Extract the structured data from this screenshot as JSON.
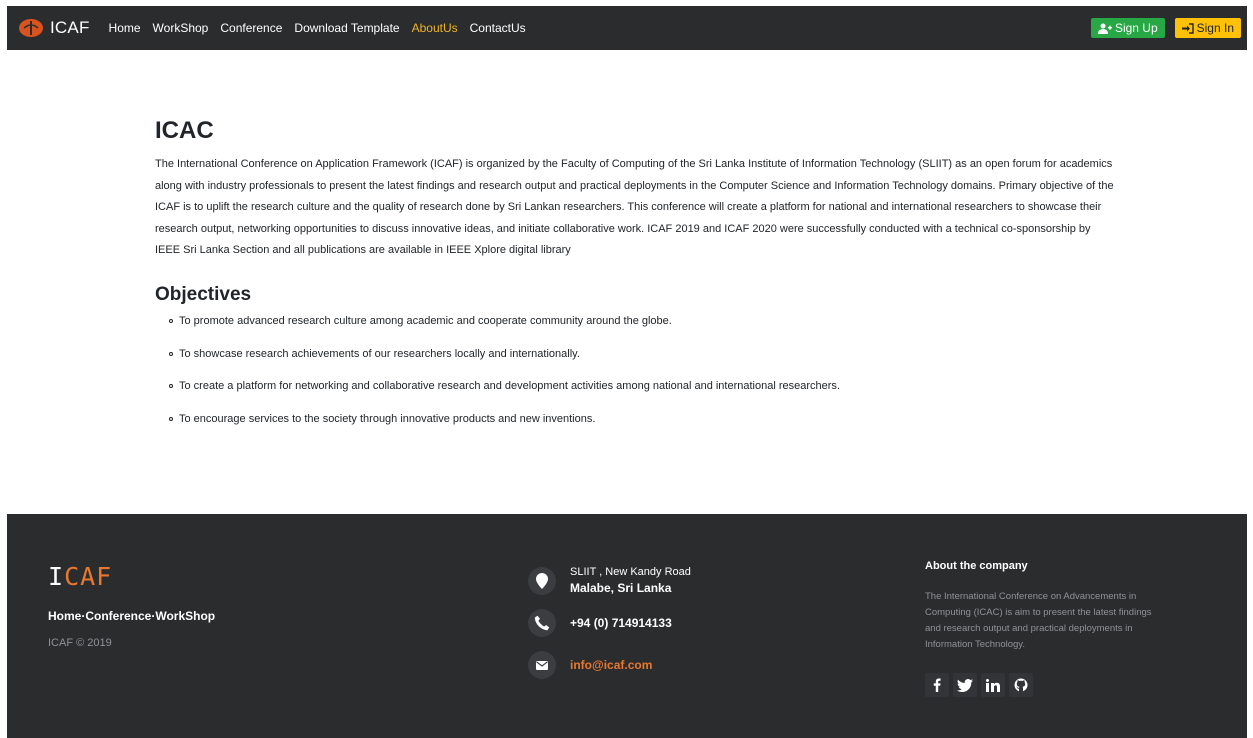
{
  "nav": {
    "brand": "ICAF",
    "links": [
      "Home",
      "WorkShop",
      "Conference",
      "Download Template",
      "AboutUs",
      "ContactUs"
    ],
    "active": "AboutUs",
    "signup": "Sign Up",
    "signin": "Sign In"
  },
  "main": {
    "title": "ICAC",
    "intro": "The International Conference on Application Framework (ICAF) is organized by the Faculty of Computing of the Sri Lanka Institute of Information Technology (SLIIT) as an open forum for academics along with industry professionals to present the latest findings and research output and practical deployments in the Computer Science and Information Technology domains. Primary objective of the ICAF is to uplift the research culture and the quality of research done by Sri Lankan researchers. This conference will create a platform for national and international researchers to showcase their research output, networking opportunities to discuss innovative ideas, and initiate collaborative work. ICAF 2019 and ICAF 2020 were successfully conducted with a technical co-sponsorship by IEEE Sri Lanka Section and all publications are available in IEEE Xplore digital library",
    "objectives_title": "Objectives",
    "objectives": [
      "To promote advanced research culture among academic and cooperate community around the globe.",
      "To showcase research achievements of our researchers locally and internationally.",
      "To create a platform for networking and collaborative research and development activities among national and international researchers.",
      "To encourage services to the society through innovative products and new inventions."
    ]
  },
  "footer": {
    "logo_first": "I",
    "logo_rest": "CAF",
    "links": "Home·Conference·WorkShop",
    "copyright": "ICAF © 2019",
    "address_line1": "SLIIT , New Kandy Road",
    "address_line2": "Malabe, Sri Lanka",
    "phone": "+94 (0) 714914133",
    "email": "info@icaf.com",
    "about_title": "About the company",
    "about_text": "The International Conference on Advancements in Computing (ICAC) is aim to present the latest findings and research output and practical deployments in Information Technology.",
    "socials": [
      "facebook-icon",
      "twitter-icon",
      "linkedin-icon",
      "github-icon"
    ]
  },
  "colors": {
    "nav_bg": "#2b2c2e",
    "active_link": "#f0b429",
    "signup": "#28a745",
    "signin": "#ffc107",
    "accent": "#e8782f"
  }
}
